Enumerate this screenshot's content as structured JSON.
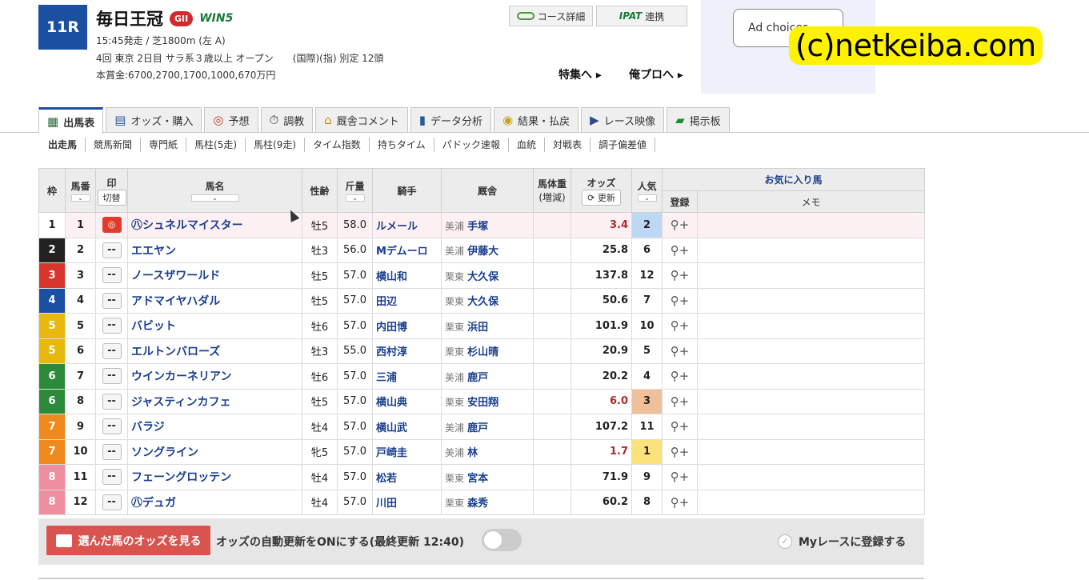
{
  "header": {
    "race_no": "11R",
    "race_name": "毎日王冠",
    "grade": "GII",
    "win5": "WIN5",
    "line1": "15:45発走 / 芝1800m (左 A)",
    "line2": "4回 東京 2日目 サラ系３歳以上 オープン　　(国際)(指) 別定 12頭",
    "line3": "本賞金:6700,2700,1700,1000,670万円",
    "course_btn": "コース詳細",
    "ipat_logo": "IPAT",
    "ipat_btn": "連携",
    "tokushu": "特集へ ▸",
    "orepro": "俺プロへ ▸",
    "ad_choices": "Ad choices",
    "watermark": "(c)netkeiba.com"
  },
  "tabs": [
    {
      "label": "出馬表",
      "icon": "table-icon"
    },
    {
      "label": "オッズ・購入",
      "icon": "odds-icon"
    },
    {
      "label": "予想",
      "icon": "target-icon"
    },
    {
      "label": "調教",
      "icon": "stopwatch-icon"
    },
    {
      "label": "厩舎コメント",
      "icon": "stable-icon"
    },
    {
      "label": "データ分析",
      "icon": "bar-chart-icon"
    },
    {
      "label": "結果・払戻",
      "icon": "coins-icon"
    },
    {
      "label": "レース映像",
      "icon": "video-icon"
    },
    {
      "label": "掲示板",
      "icon": "chat-icon"
    }
  ],
  "subnav": [
    "出走馬",
    "競馬新聞",
    "専門紙",
    "馬柱(5走)",
    "馬柱(9走)",
    "タイム指数",
    "持ちタイム",
    "パドック速報",
    "血統",
    "対戦表",
    "調子偏差値"
  ],
  "table": {
    "headers": {
      "waku": "枠",
      "umaban": "馬番",
      "mark": "印",
      "mark_btn": "切替",
      "horse": "馬名",
      "sexage": "性齢",
      "weight": "斤量",
      "jockey": "騎手",
      "stable": "厩舎",
      "bodyweight": "馬体重",
      "bodyweight_sub": "(増減)",
      "odds": "オッズ",
      "odds_btn": "更新",
      "popularity": "人気",
      "favorite": "お気に入り馬",
      "register": "登録",
      "memo": "メモ",
      "sort": "⌄"
    },
    "rows": [
      {
        "waku": "1",
        "umaban": "1",
        "mark": "◎",
        "horse": "㊇シュネルマイスター",
        "sexage": "牡5",
        "weight": "58.0",
        "jockey": "ルメール",
        "area": "美浦",
        "trainer": "手塚",
        "odds": "3.4",
        "pop": "2"
      },
      {
        "waku": "2",
        "umaban": "2",
        "mark": "--",
        "horse": "エエヤン",
        "sexage": "牡3",
        "weight": "56.0",
        "jockey": "Mデムーロ",
        "area": "美浦",
        "trainer": "伊藤大",
        "odds": "25.8",
        "pop": "6"
      },
      {
        "waku": "3",
        "umaban": "3",
        "mark": "--",
        "horse": "ノースザワールド",
        "sexage": "牡5",
        "weight": "57.0",
        "jockey": "横山和",
        "area": "栗東",
        "trainer": "大久保",
        "odds": "137.8",
        "pop": "12"
      },
      {
        "waku": "4",
        "umaban": "4",
        "mark": "--",
        "horse": "アドマイヤハダル",
        "sexage": "牡5",
        "weight": "57.0",
        "jockey": "田辺",
        "area": "栗東",
        "trainer": "大久保",
        "odds": "50.6",
        "pop": "7"
      },
      {
        "waku": "5",
        "umaban": "5",
        "mark": "--",
        "horse": "バビット",
        "sexage": "牡6",
        "weight": "57.0",
        "jockey": "内田博",
        "area": "栗東",
        "trainer": "浜田",
        "odds": "101.9",
        "pop": "10"
      },
      {
        "waku": "5",
        "umaban": "6",
        "mark": "--",
        "horse": "エルトンバローズ",
        "sexage": "牡3",
        "weight": "55.0",
        "jockey": "西村淳",
        "area": "栗東",
        "trainer": "杉山晴",
        "odds": "20.9",
        "pop": "5"
      },
      {
        "waku": "6",
        "umaban": "7",
        "mark": "--",
        "horse": "ウインカーネリアン",
        "sexage": "牡6",
        "weight": "57.0",
        "jockey": "三浦",
        "area": "美浦",
        "trainer": "鹿戸",
        "odds": "20.2",
        "pop": "4"
      },
      {
        "waku": "6",
        "umaban": "8",
        "mark": "--",
        "horse": "ジャスティンカフェ",
        "sexage": "牡5",
        "weight": "57.0",
        "jockey": "横山典",
        "area": "栗東",
        "trainer": "安田翔",
        "odds": "6.0",
        "pop": "3"
      },
      {
        "waku": "7",
        "umaban": "9",
        "mark": "--",
        "horse": "バラジ",
        "sexage": "牡4",
        "weight": "57.0",
        "jockey": "横山武",
        "area": "美浦",
        "trainer": "鹿戸",
        "odds": "107.2",
        "pop": "11"
      },
      {
        "waku": "7",
        "umaban": "10",
        "mark": "--",
        "horse": "ソングライン",
        "sexage": "牝5",
        "weight": "57.0",
        "jockey": "戸崎圭",
        "area": "美浦",
        "trainer": "林",
        "odds": "1.7",
        "pop": "1"
      },
      {
        "waku": "8",
        "umaban": "11",
        "mark": "--",
        "horse": "フェーングロッテン",
        "sexage": "牡4",
        "weight": "57.0",
        "jockey": "松若",
        "area": "栗東",
        "trainer": "宮本",
        "odds": "71.9",
        "pop": "9"
      },
      {
        "waku": "8",
        "umaban": "12",
        "mark": "--",
        "horse": "㊇デュガ",
        "sexage": "牡4",
        "weight": "57.0",
        "jockey": "川田",
        "area": "栗東",
        "trainer": "森秀",
        "odds": "60.2",
        "pop": "8"
      }
    ]
  },
  "colors": {
    "waku": {
      "1": "#ffffff",
      "2": "#222222",
      "3": "#d9352c",
      "4": "#1a4fa3",
      "5": "#e8b80c",
      "6": "#2a8a3a",
      "7": "#f08a1c",
      "8": "#ee8ea0"
    },
    "pop": {
      "1": "#fbe27a",
      "2": "#bcd8f5",
      "3": "#f0c09a"
    },
    "accent": "#1b4fa0",
    "odds_red": "#b02a2a"
  },
  "bottom": {
    "odds_btn": "選んだ馬のオッズを見る",
    "auto_update": "オッズの自動更新をONにする(最終更新 12:40)",
    "myrace": "Myレースに登録する"
  }
}
